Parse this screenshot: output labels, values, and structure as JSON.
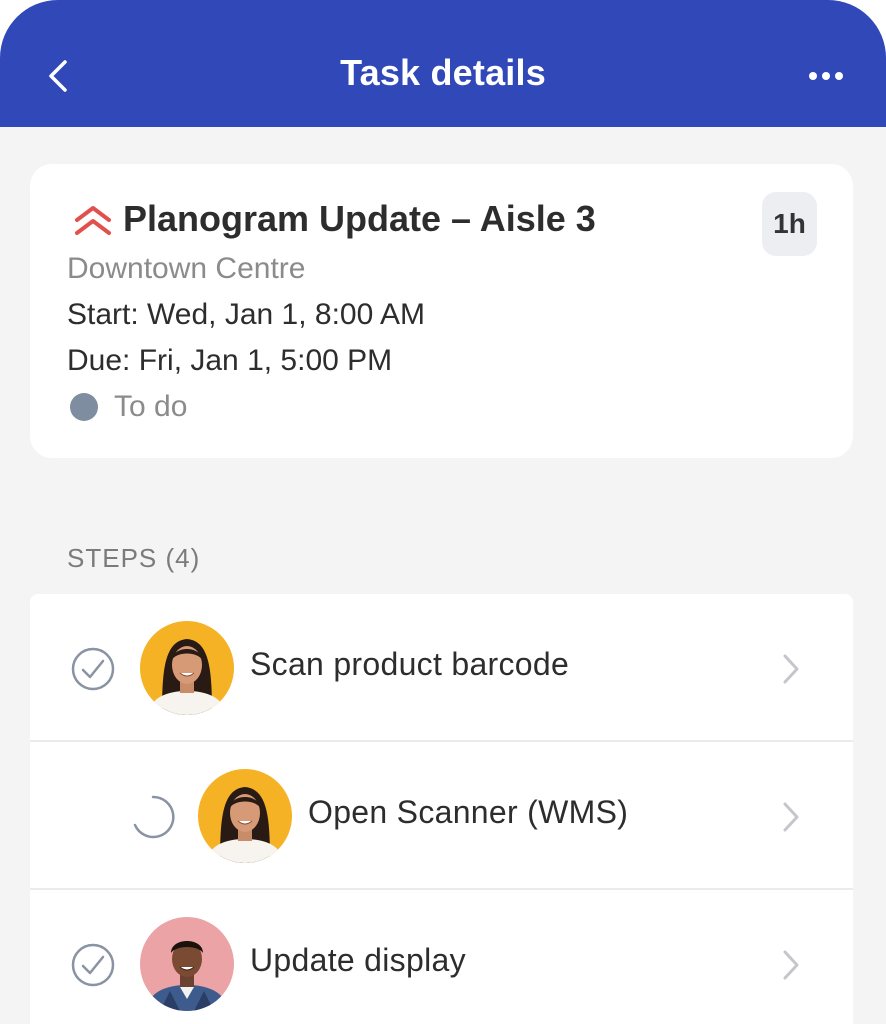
{
  "header": {
    "title": "Task details"
  },
  "task": {
    "title": "Planogram Update – Aisle 3",
    "duration": "1h",
    "location": "Downtown Centre",
    "start": "Start: Wed, Jan 1, 8:00 AM",
    "due": "Fri, Jan 1, 5:00 PM",
    "due_label": "Due:",
    "status": "To do",
    "priority_icon": "chevron-double-up-icon"
  },
  "steps": {
    "heading": "STEPS (4)",
    "items": [
      {
        "label": "Scan product barcode",
        "state": "complete",
        "avatar": "woman-avatar"
      },
      {
        "label": "Open Scanner (WMS)",
        "state": "in-progress",
        "avatar": "woman-avatar"
      },
      {
        "label": "Update display",
        "state": "complete",
        "avatar": "man-avatar"
      }
    ]
  },
  "colors": {
    "header_bg": "#3148b8",
    "priority": "#e2504e",
    "status_dot": "#7f8da0"
  }
}
